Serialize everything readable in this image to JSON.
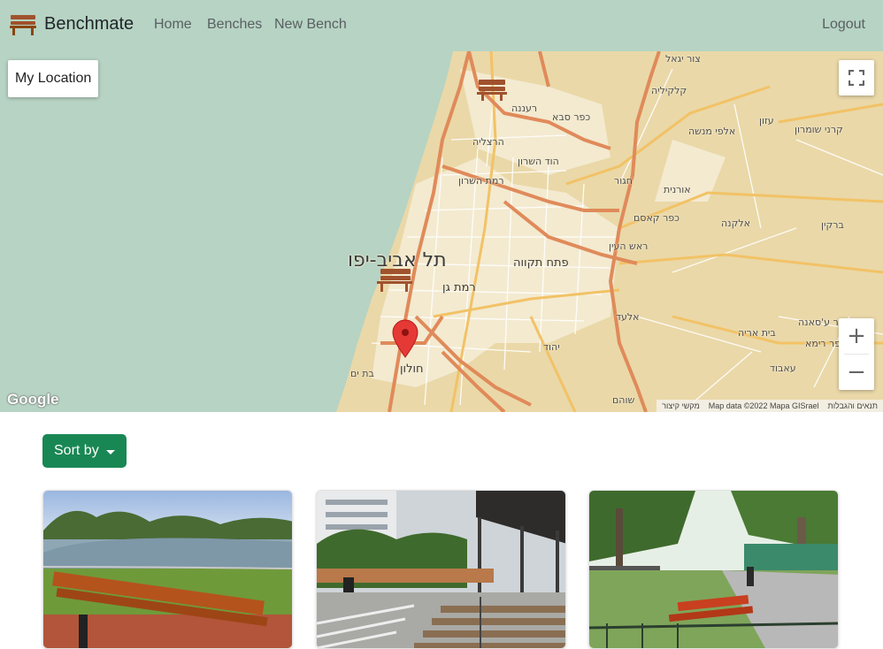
{
  "navbar": {
    "brand": "Benchmate",
    "links": {
      "home": "Home",
      "benches": "Benches",
      "new_bench": "New Bench"
    },
    "logout": "Logout"
  },
  "map": {
    "my_location_label": "My Location",
    "zoom_in": "+",
    "zoom_out": "−",
    "google_logo": "Google",
    "attribution": {
      "terms": "תנאים והגבלות",
      "map_data": "Map data ©2022 Mapa GISrael",
      "shortcuts": "מקשי קיצור"
    },
    "places": {
      "tel_aviv": "תל אביב-יפו",
      "ramat_gan": "רמת גן",
      "holon": "חולון",
      "bat_yam": "בת ים",
      "petah_tikva": "פתח תקווה",
      "raanana": "רעננה",
      "kfar_saba": "כפר סבא",
      "herzliya": "הרצליה",
      "hod_hasharon": "הוד השרון",
      "ramat_hasharon": "רמת השרון",
      "qalqilya": "קלקיליה",
      "tzur_yigal": "צור יגאל",
      "azun": "עזון",
      "alfei_menashe": "אלפי מנשה",
      "karnei_shomron": "קרני שומרון",
      "hagor": "חגור",
      "oranit": "אורנית",
      "kfar_kasem": "כפר קאסם",
      "elkana": "אלקנה",
      "brukin": "ברקין",
      "rosh_haayin": "ראש העין",
      "elad": "אלעד",
      "yehud": "יהוד",
      "kafr_sansa": "כפר ע'סאנה",
      "beit_arye": "בית אריה",
      "kafr_rima": "כפר רימא",
      "avud": "עאבוד",
      "shoham": "שוהם"
    }
  },
  "sort": {
    "label": "Sort by"
  },
  "benches": [
    {
      "scene": "lake-park"
    },
    {
      "scene": "plaza-steps"
    },
    {
      "scene": "boulevard"
    }
  ],
  "colors": {
    "navbar": "#b6d3c3",
    "sea": "#aad3df",
    "land": "#ead8a8",
    "highway": "#e08a5a",
    "major_road": "#f2c266",
    "sort_button": "#198754",
    "marker": "#e53935",
    "bench_icon": "#a0522d"
  },
  "icons": {
    "brand": "bench-icon",
    "marker": "map-pin-icon",
    "fullscreen": "fullscreen-icon",
    "sort_caret": "caret-down-icon"
  }
}
